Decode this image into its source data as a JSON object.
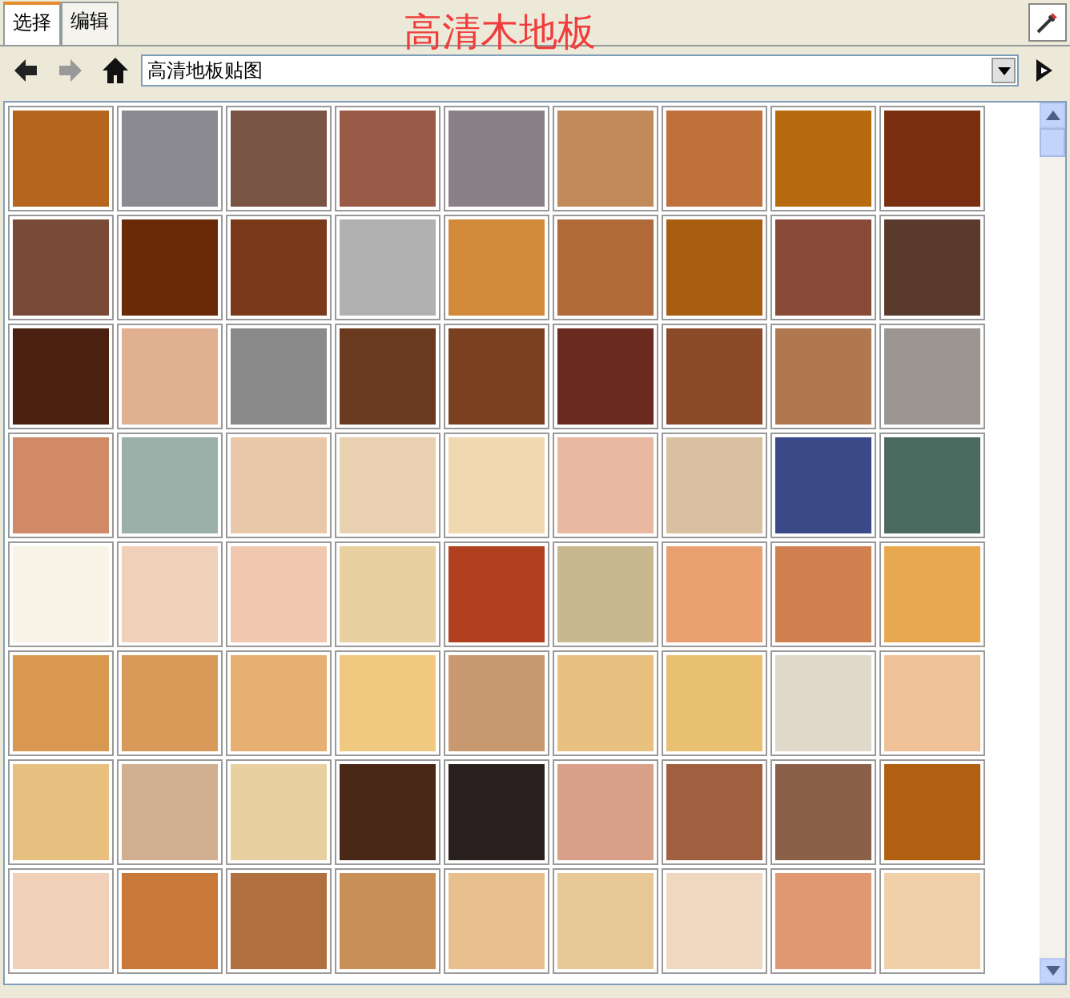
{
  "tabs": [
    {
      "label": "选择",
      "selected": true
    },
    {
      "label": "编辑",
      "selected": false
    }
  ],
  "heading": "高清木地板",
  "collection": {
    "value": "高清地板贴图"
  },
  "materials": [
    {
      "color": "#b5651d"
    },
    {
      "color": "#8a8a90"
    },
    {
      "color": "#7a5545"
    },
    {
      "color": "#9a5a48"
    },
    {
      "color": "#8a8088"
    },
    {
      "color": "#c08a5a"
    },
    {
      "color": "#c0703a"
    },
    {
      "color": "#b86a10"
    },
    {
      "color": "#7a3010"
    },
    {
      "color": "#7a4a38"
    },
    {
      "color": "#6a2a08"
    },
    {
      "color": "#7a3a1a"
    },
    {
      "color": "#b0b0b0"
    },
    {
      "color": "#d08a3a"
    },
    {
      "color": "#b06a3a"
    },
    {
      "color": "#a85e10"
    },
    {
      "color": "#8a4a38"
    },
    {
      "color": "#5a3a2a"
    },
    {
      "color": "#4a2010"
    },
    {
      "color": "#e0b090"
    },
    {
      "color": "#8a8a8a"
    },
    {
      "color": "#6a3a20"
    },
    {
      "color": "#7a4020"
    },
    {
      "color": "#6a2a20"
    },
    {
      "color": "#8a4a28"
    },
    {
      "color": "#b07850"
    },
    {
      "color": "#9a9590"
    },
    {
      "color": "#d08a68"
    },
    {
      "color": "#9ab0a8"
    },
    {
      "color": "#e8c8a8"
    },
    {
      "color": "#e8d0b0"
    },
    {
      "color": "#f0d8b0"
    },
    {
      "color": "#e8b8a0"
    },
    {
      "color": "#d8c0a0"
    },
    {
      "color": "#3a4a88"
    },
    {
      "color": "#4a6a60"
    },
    {
      "color": "#f8f4e8"
    },
    {
      "color": "#f0d0b8"
    },
    {
      "color": "#f0c8b0"
    },
    {
      "color": "#e8d0a0"
    },
    {
      "color": "#b04020"
    },
    {
      "color": "#c8b890"
    },
    {
      "color": "#e8a070"
    },
    {
      "color": "#d08050"
    },
    {
      "color": "#e8a850"
    },
    {
      "color": "#d89850"
    },
    {
      "color": "#d89a58"
    },
    {
      "color": "#e8b070"
    },
    {
      "color": "#f0c880"
    },
    {
      "color": "#c89870"
    },
    {
      "color": "#e8c080"
    },
    {
      "color": "#e8c070"
    },
    {
      "color": "#e0d8c8"
    },
    {
      "color": "#f0c098"
    },
    {
      "color": "#e8c080"
    },
    {
      "color": "#d0b090"
    },
    {
      "color": "#e8d0a0"
    },
    {
      "color": "#4a2818"
    },
    {
      "color": "#2a2020"
    },
    {
      "color": "#d8a088"
    },
    {
      "color": "#a06040"
    },
    {
      "color": "#8a6048"
    },
    {
      "color": "#b06010"
    },
    {
      "color": "#f0d0b8"
    },
    {
      "color": "#c87838"
    },
    {
      "color": "#b07040"
    },
    {
      "color": "#c89058"
    },
    {
      "color": "#e8c090"
    },
    {
      "color": "#e8c898"
    },
    {
      "color": "#f0d8c0"
    },
    {
      "color": "#e09870"
    },
    {
      "color": "#f0d0a8"
    }
  ]
}
